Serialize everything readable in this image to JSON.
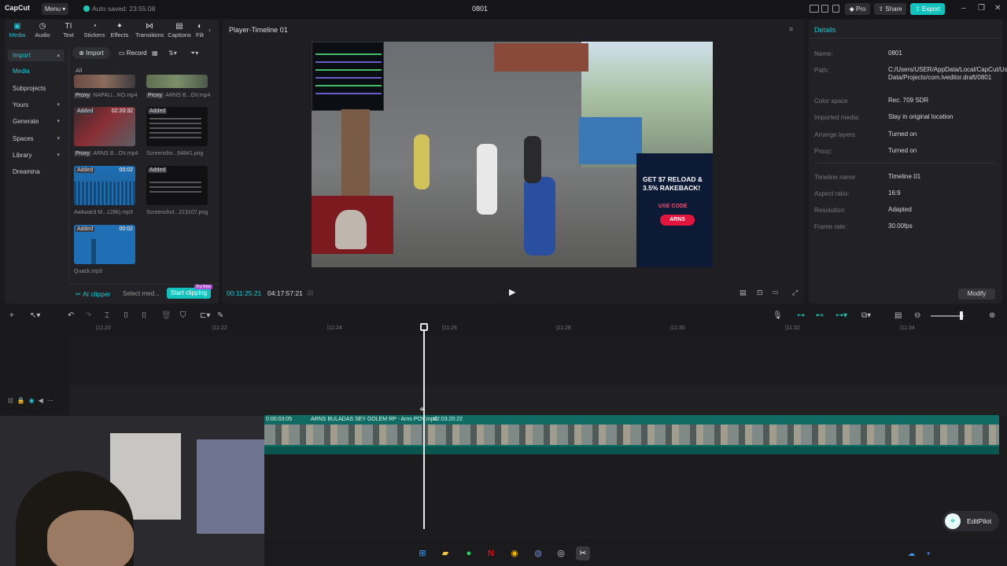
{
  "titlebar": {
    "app_name": "CapCut",
    "menu_label": "Menu",
    "autosave": "Auto saved: 23:55:08",
    "project_title": "0801",
    "pro_label": "Pro",
    "share_label": "Share",
    "export_label": "Export"
  },
  "media_tabs": [
    {
      "label": "Media",
      "icon": "media-icon"
    },
    {
      "label": "Audio",
      "icon": "audio-icon"
    },
    {
      "label": "Text",
      "icon": "text-icon"
    },
    {
      "label": "Stickers",
      "icon": "stickers-icon"
    },
    {
      "label": "Effects",
      "icon": "effects-icon"
    },
    {
      "label": "Transitions",
      "icon": "transitions-icon"
    },
    {
      "label": "Captions",
      "icon": "captions-icon"
    },
    {
      "label": "Filt",
      "icon": "filters-icon"
    }
  ],
  "sidebar": {
    "import": "Import",
    "media": "Media",
    "subprojects": "Subprojects",
    "yours": "Yours",
    "generate": "Generate",
    "spaces": "Spaces",
    "library": "Library",
    "dreamina": "Dreamina"
  },
  "media_toolbar": {
    "import": "Import",
    "record": "Record",
    "all": "All"
  },
  "media_items": [
    {
      "tag": "Proxy",
      "duration": "",
      "name": "NAPALI...NO.mp4"
    },
    {
      "tag": "Proxy",
      "duration": "",
      "name": "ARNS B...OV.mp4"
    },
    {
      "tag": "Added",
      "duration": "02:20:32",
      "name": "ARNS B...OV.mp4",
      "tag2": "Proxy"
    },
    {
      "tag": "Added",
      "duration": "",
      "name": "Screensho...94841.png"
    },
    {
      "tag": "Added",
      "duration": "00:02",
      "name": "Awkward M...128k).mp3"
    },
    {
      "tag": "Added",
      "duration": "",
      "name": "Screenshot...213107.png"
    },
    {
      "tag": "Added",
      "duration": "00:02",
      "name": "Quack.mp3"
    }
  ],
  "media_footer": {
    "ai_clipper": "AI clipper",
    "select_media": "Select med...",
    "start_clipping": "Start clipping",
    "try_free": "Try free"
  },
  "player": {
    "title": "Player-Timeline 01",
    "current_time": "00:11:25:21",
    "total_time": "04:17:57:21",
    "stake_promo": "GET $7 RELOAD & 3.5% RAKEBACK!",
    "use_code": "USE CODE",
    "code": "ARNS"
  },
  "details": {
    "title": "Details",
    "rows": [
      {
        "label": "Name:",
        "value": "0801"
      },
      {
        "label": "Path:",
        "value": "C:/Users/USER/AppData/Local/CapCut/User Data/Projects/com.lveditor.draft/0801"
      },
      {
        "label": "Color space",
        "value": "Rec. 709 SDR"
      },
      {
        "label": "Imported media:",
        "value": "Stay in original location"
      },
      {
        "label": "Arrange layers",
        "value": "Turned on"
      },
      {
        "label": "Proxy:",
        "value": "Turned on"
      },
      {
        "label": "Timeline name",
        "value": "Timeline 01"
      },
      {
        "label": "Aspect ratio:",
        "value": "16:9"
      },
      {
        "label": "Resolution:",
        "value": "Adapted"
      },
      {
        "label": "Frame rate:",
        "value": "30.00fps"
      }
    ],
    "modify": "Modify"
  },
  "timeline": {
    "ruler": [
      "|11:20",
      "|11:22",
      "|11:24",
      "|11:26",
      "|11:28",
      "|11:30",
      "|11:32",
      "|11:34"
    ],
    "clip_start": "0:00:03:05",
    "clip_name": "ARNS BULADAS SEY GOLEM RP - Arns POV.mp4",
    "clip_duration": "02:03:20:22"
  },
  "editpilot": {
    "label": "EditPilot"
  },
  "colors": {
    "accent": "#1fc7d4",
    "export": "#14c2bd",
    "clip": "#0f6b63"
  }
}
